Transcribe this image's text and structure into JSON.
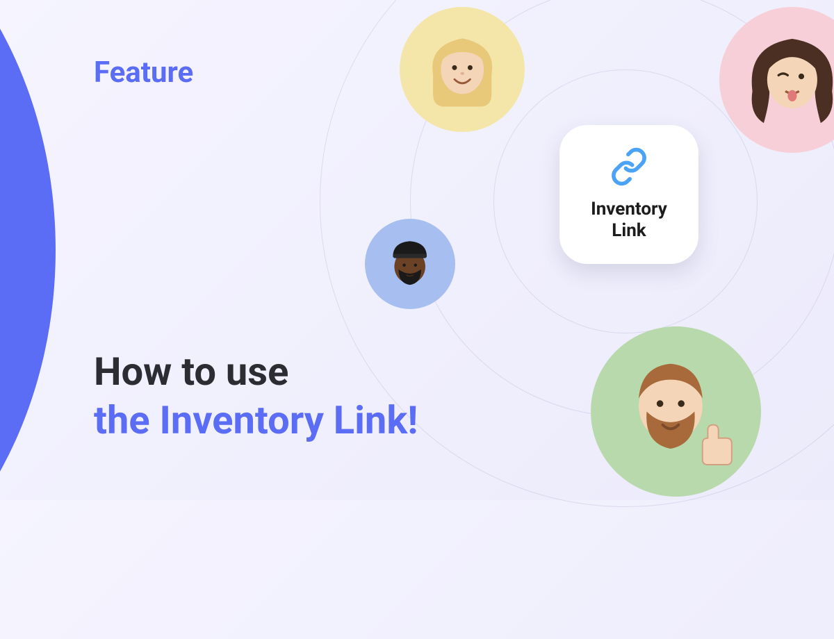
{
  "category": "Feature",
  "headline": {
    "line1": "How to use",
    "line2": "the Inventory Link!"
  },
  "card": {
    "label": "Inventory\nLink"
  },
  "colors": {
    "accent": "#5b6cf5",
    "text": "#2c2c33"
  },
  "avatars": [
    {
      "bg": "#f4e6a8",
      "name": "avatar-1"
    },
    {
      "bg": "#f7cfd8",
      "name": "avatar-2"
    },
    {
      "bg": "#a7bff0",
      "name": "avatar-3"
    },
    {
      "bg": "#b8d9ab",
      "name": "avatar-4"
    }
  ]
}
